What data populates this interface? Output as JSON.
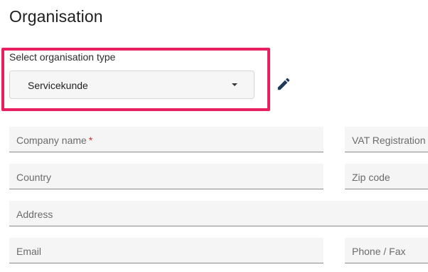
{
  "page": {
    "title": "Organisation"
  },
  "organisation_type": {
    "label": "Select organisation type",
    "selected_value": "Servicekunde"
  },
  "form": {
    "company_name": {
      "label": "Company name",
      "required_marker": "*"
    },
    "vat_registration": {
      "label": "VAT Registration"
    },
    "country": {
      "label": "Country"
    },
    "zip_code": {
      "label": "Zip code"
    },
    "address": {
      "label": "Address"
    },
    "email": {
      "label": "Email"
    },
    "phone_fax": {
      "label": "Phone / Fax"
    }
  },
  "icons": {
    "edit": "pencil-icon",
    "dropdown": "caret-down-icon"
  },
  "colors": {
    "highlight": "#e8205f",
    "edit_icon": "#1f3a5a",
    "required": "#d32f2f"
  }
}
